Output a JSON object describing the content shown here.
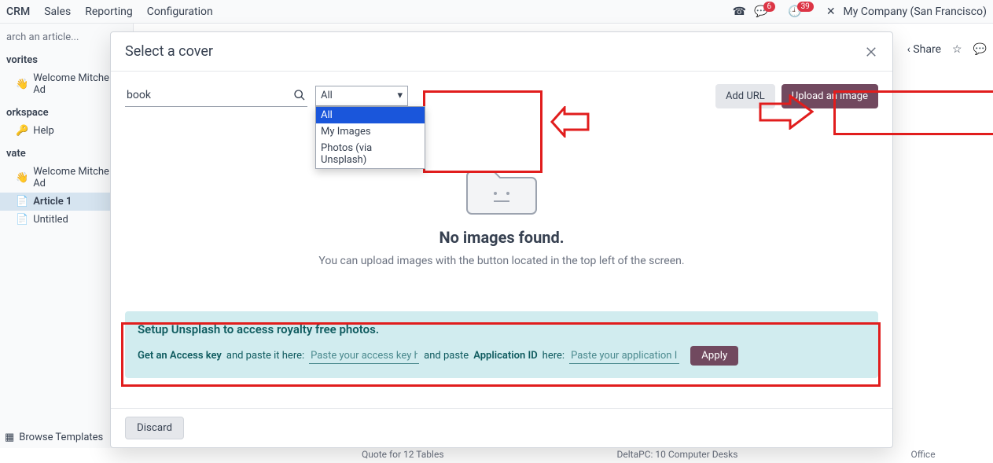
{
  "topmenu": {
    "app": "CRM",
    "items": [
      "Sales",
      "Reporting",
      "Configuration"
    ]
  },
  "topright": {
    "msg_badge": "6",
    "clock_badge": "39",
    "company": "My Company (San Francisco)"
  },
  "leftpane": {
    "search_placeholder": "arch an article...",
    "favorites": "vorites",
    "fav_item": "Welcome Mitchell Ad",
    "workspace": "orkspace",
    "help": "Help",
    "private": "vate",
    "priv_item": "Welcome Mitchell Ad",
    "article": "Article 1",
    "untitled": "Untitled",
    "browse": "Browse Templates"
  },
  "sharebar": {
    "share": "Share"
  },
  "modal": {
    "title": "Select a cover",
    "search_value": "book",
    "filter_selected": "All",
    "filter_options": [
      "All",
      "My Images",
      "Photos (via Unsplash)"
    ],
    "add_url": "Add URL",
    "upload": "Upload an image",
    "empty_title": "No images found.",
    "empty_sub": "You can upload images with the button located in the top left of the screen.",
    "unsplash_title": "Setup Unsplash to access royalty free photos.",
    "unsplash_link": "Get an Access key",
    "unsplash_t1": "and paste it here:",
    "unsplash_ph1": "Paste your access key here",
    "unsplash_t2": "and paste",
    "unsplash_bold": "Application ID",
    "unsplash_t3": "here:",
    "unsplash_ph2": "Paste your application ID",
    "apply": "Apply",
    "discard": "Discard"
  },
  "bg": {
    "a": "Quote for 12 Tables",
    "b": "DeltaPC: 10 Computer Desks",
    "c": "Office"
  }
}
